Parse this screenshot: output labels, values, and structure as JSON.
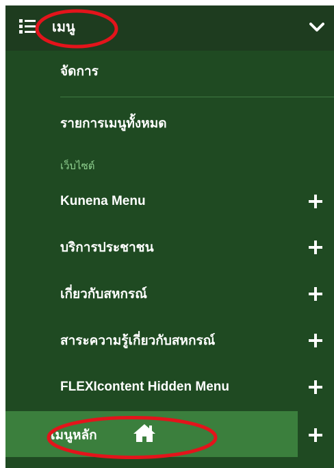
{
  "header": {
    "title": "เมนู",
    "list_icon": "list-icon",
    "chevron_icon": "chevron-down-icon"
  },
  "items": [
    {
      "label": "จัดการ",
      "has_plus": false
    },
    {
      "label": "รายการเมนูทั้งหมด",
      "has_plus": false
    }
  ],
  "section": {
    "label": "เว็บไซต์"
  },
  "site_items": [
    {
      "label": "Kunena Menu",
      "expand_icon": "plus-icon"
    },
    {
      "label": "บริการประชาชน",
      "expand_icon": "plus-icon"
    },
    {
      "label": "เกี่ยวกับสหกรณ์",
      "expand_icon": "plus-icon"
    },
    {
      "label": "สาระความรู้เกี่ยวกับสหกรณ์",
      "expand_icon": "plus-icon"
    },
    {
      "label": "FLEXIcontent Hidden Menu",
      "expand_icon": "plus-icon"
    }
  ],
  "active_item": {
    "label": "เมนูหลัก",
    "home_icon": "home-icon",
    "expand_icon": "plus-icon"
  },
  "colors": {
    "panel_bg": "#1f4a22",
    "header_bg": "#1e3c1f",
    "active_bg": "#3b7f3d",
    "section_label": "#8fd08f",
    "annotation": "#e3141b",
    "text": "#ffffff"
  }
}
